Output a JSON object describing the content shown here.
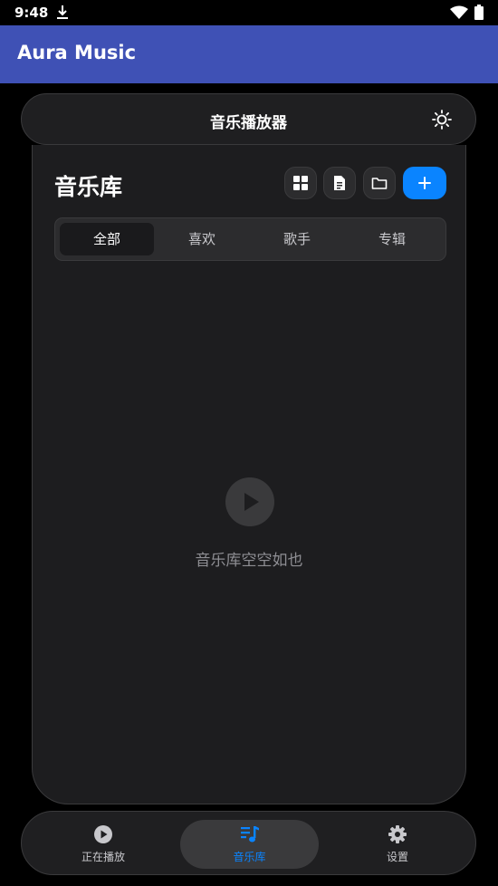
{
  "status_bar": {
    "time": "9:48"
  },
  "app_bar": {
    "title": "Aura Music"
  },
  "header": {
    "title": "音乐播放器"
  },
  "library": {
    "title": "音乐库",
    "tabs": [
      {
        "label": "全部",
        "active": true
      },
      {
        "label": "喜欢",
        "active": false
      },
      {
        "label": "歌手",
        "active": false
      },
      {
        "label": "专辑",
        "active": false
      }
    ],
    "empty_text": "音乐库空空如也"
  },
  "toolbar_icons": [
    "grid-icon",
    "document-icon",
    "folder-icon",
    "plus-icon"
  ],
  "bottom_nav": {
    "items": [
      {
        "label": "正在播放",
        "icon": "play-circle-icon",
        "active": false
      },
      {
        "label": "音乐库",
        "icon": "music-queue-icon",
        "active": true
      },
      {
        "label": "设置",
        "icon": "gear-icon",
        "active": false
      }
    ]
  },
  "colors": {
    "app_bar": "#3f51b5",
    "accent": "#0a84ff",
    "background": "#000000",
    "card": "#1d1d1f"
  }
}
